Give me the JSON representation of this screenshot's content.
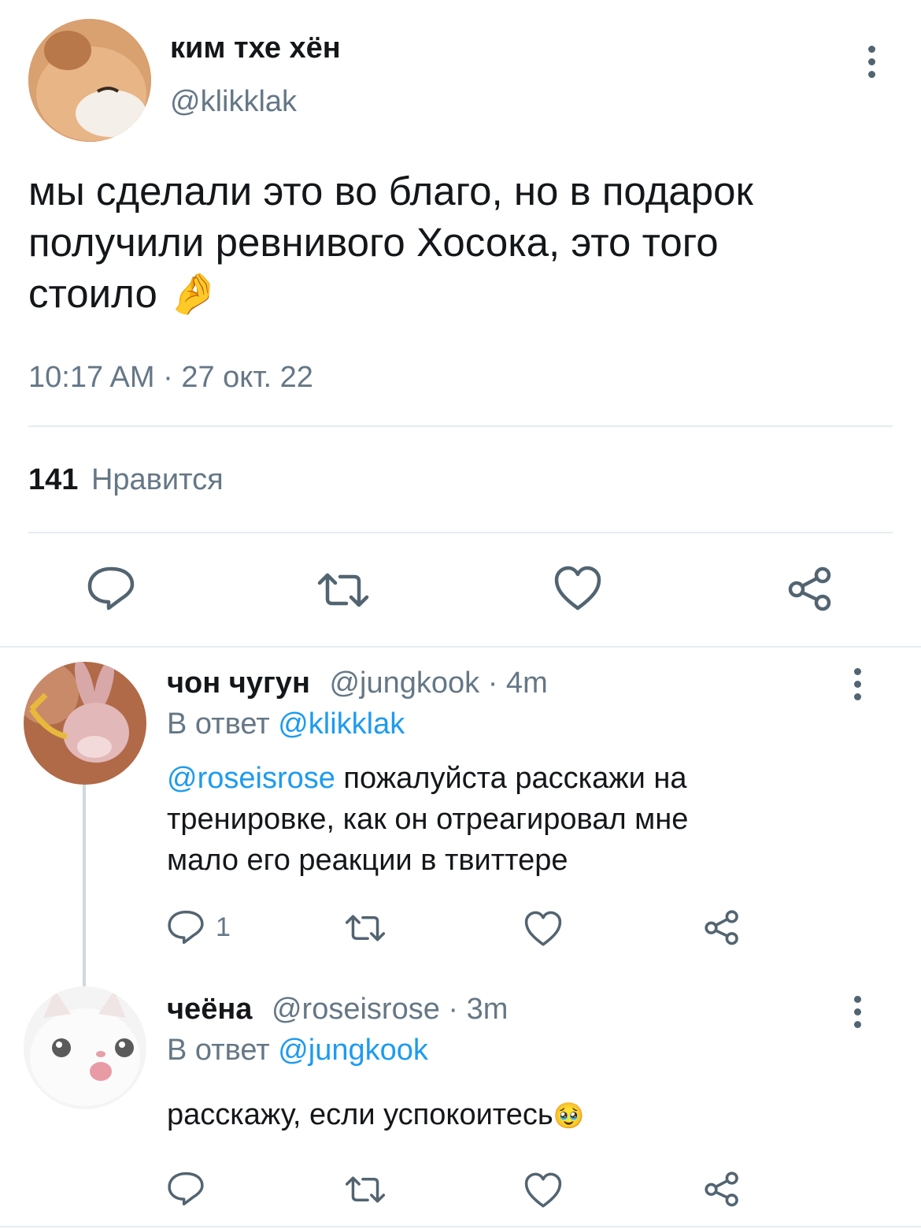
{
  "main_tweet": {
    "author_name": "ким тхе хён",
    "author_handle": "@klikklak",
    "text_lines": [
      "мы сделали это во благо, но в подарок",
      "получили ревнивого Хосока, это того",
      "стоило"
    ],
    "text_emoji": "🤌",
    "timestamp": "10:17 AM · 27 окт. 22",
    "likes_count": "141",
    "likes_label": "Нравится"
  },
  "reply1": {
    "author_name": "чон чугун",
    "author_handle": "@jungkook",
    "time": "· 4m",
    "reply_to_label": "В ответ",
    "reply_to_handle": "@klikklak",
    "mention": "@roseisrose",
    "text_line1": " пожалуйста расскажи на",
    "text_line2": "тренировке, как он отреагировал мне",
    "text_line3": "мало его реакции в твиттере",
    "reply_count": "1"
  },
  "reply2": {
    "author_name": "чеёна",
    "author_handle": "@roseisrose",
    "time": "· 3m",
    "reply_to_label": "В ответ",
    "reply_to_handle": "@jungkook",
    "text": "расскажу, если успокоитесь",
    "text_emoji": "🥹"
  },
  "colors": {
    "text": "#14171a",
    "muted": "#657786",
    "link": "#1d9bf0",
    "icon": "#536471",
    "divider": "#e6ecf0"
  },
  "icons": [
    "more-icon",
    "reply-icon",
    "retweet-icon",
    "like-icon",
    "share-icon"
  ]
}
